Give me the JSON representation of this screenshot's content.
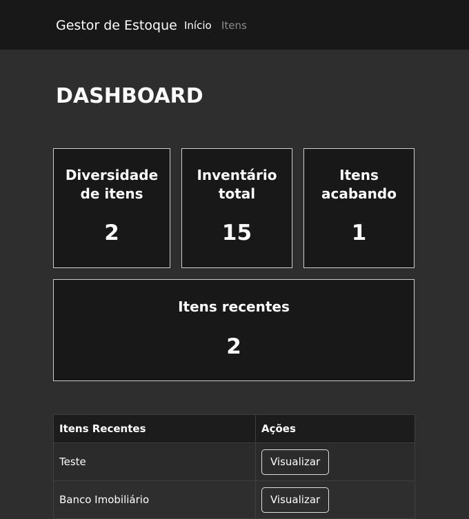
{
  "navbar": {
    "brand": "Gestor de Estoque",
    "links": [
      {
        "label": "Início",
        "active": true
      },
      {
        "label": "Itens",
        "active": false
      }
    ]
  },
  "page": {
    "title": "DASHBOARD"
  },
  "cards": {
    "diversity": {
      "title": "Diversidade de itens",
      "value": "2"
    },
    "total": {
      "title": "Inventário total",
      "value": "15"
    },
    "ending": {
      "title": "Itens acabando",
      "value": "1"
    },
    "recent": {
      "title": "Itens recentes",
      "value": "2"
    }
  },
  "recent_table": {
    "headers": [
      "Itens Recentes",
      "Ações"
    ],
    "rows": [
      {
        "name": "Teste",
        "action": "Visualizar"
      },
      {
        "name": "Banco Imobiliário",
        "action": "Visualizar"
      }
    ]
  },
  "colors": {
    "navbar_bg": "#181818",
    "page_bg": "#2e2e2e",
    "card_bg": "#181818",
    "card_border": "#cfcfcf",
    "text": "#ffffff",
    "muted_link": "#8c8c8c"
  }
}
